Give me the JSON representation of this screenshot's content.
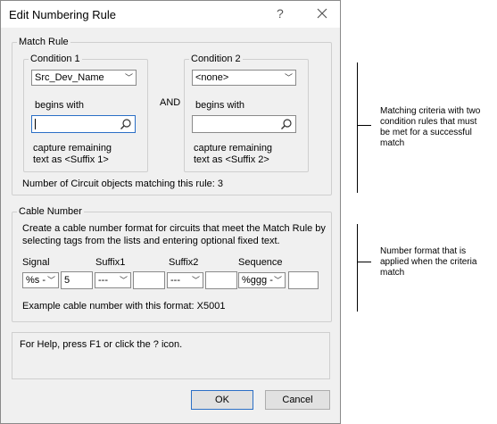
{
  "window": {
    "title": "Edit Numbering Rule",
    "help_glyph": "?"
  },
  "match_rule": {
    "legend": "Match Rule",
    "condition1": {
      "legend": "Condition 1",
      "selected": "Src_Dev_Name",
      "operator": "begins with",
      "value": "",
      "capture_line1": "capture remaining",
      "capture_line2": "text as <Suffix 1>"
    },
    "and_label": "AND",
    "condition2": {
      "legend": "Condition 2",
      "selected": "<none>",
      "operator": "begins with",
      "value": "",
      "capture_line1": "capture remaining",
      "capture_line2": "text as <Suffix 2>"
    },
    "match_count_label": "Number of Circuit objects matching this rule:",
    "match_count": "3"
  },
  "cable_number": {
    "legend": "Cable Number",
    "description_line1": "Create a cable number format for circuits that meet the Match Rule by",
    "description_line2": "selecting tags from the lists and entering optional fixed text.",
    "columns": [
      {
        "label": "Signal",
        "selected": "%s -",
        "text": "5"
      },
      {
        "label": "Suffix1",
        "selected": "---",
        "text": ""
      },
      {
        "label": "Suffix2",
        "selected": "---",
        "text": ""
      },
      {
        "label": "Sequence",
        "selected": "%ggg -",
        "text": ""
      }
    ],
    "example_label": "Example cable number with this format:",
    "example_value": "X5001"
  },
  "help_text": "For Help, press F1 or click the ? icon.",
  "buttons": {
    "ok": "OK",
    "cancel": "Cancel"
  },
  "annotations": {
    "match_line1": "Matching criteria with two",
    "match_line2": "condition rules that must",
    "match_line3": "be met for a successful",
    "match_line4": "match",
    "format_line1": "Number format that is",
    "format_line2": "applied when the criteria",
    "format_line3": "match"
  },
  "icons": {
    "close": "close-icon",
    "search": "magnifier-icon",
    "dropdown": "chevron-down-icon"
  }
}
